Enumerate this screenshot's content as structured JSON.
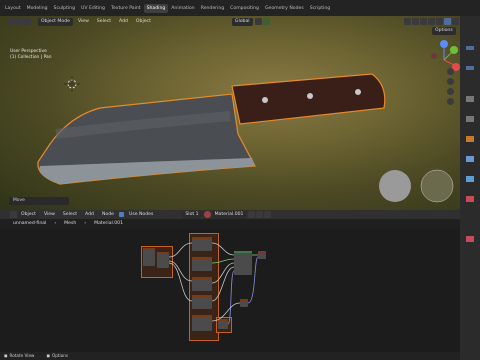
{
  "topbar": {
    "workspaces": [
      "Layout",
      "Modeling",
      "Sculpting",
      "UV Editing",
      "Texture Paint",
      "Shading",
      "Animation",
      "Rendering",
      "Compositing",
      "Geometry Nodes",
      "Scripting"
    ],
    "active_workspace": "Shading"
  },
  "viewport": {
    "mode": "Object Mode",
    "menus": [
      "View",
      "Select",
      "Add",
      "Object"
    ],
    "orientation": "Global",
    "options_label": "Options",
    "info_lines": [
      "User Perspective",
      "(1) Collection | Pan",
      "",
      "",
      ""
    ],
    "status_text": "Move",
    "axis_labels": {
      "x": "X",
      "y": "Y",
      "z": "Z"
    }
  },
  "node_editor": {
    "editor_type": "Object",
    "menus": [
      "View",
      "Select",
      "Add",
      "Node"
    ],
    "use_nodes_label": "Use Nodes",
    "use_nodes_checked": true,
    "slot": "Slot 1",
    "material": "Material.001",
    "breadcrumb": [
      "unnamed-final",
      "Mesh",
      "Material.001"
    ]
  },
  "statusbar": {
    "left": "Rotate View",
    "right": "Options"
  },
  "colors": {
    "accent_orange": "#e58b2a",
    "frame_orange": "#c46020",
    "active_tab": "#3f3f3f"
  }
}
